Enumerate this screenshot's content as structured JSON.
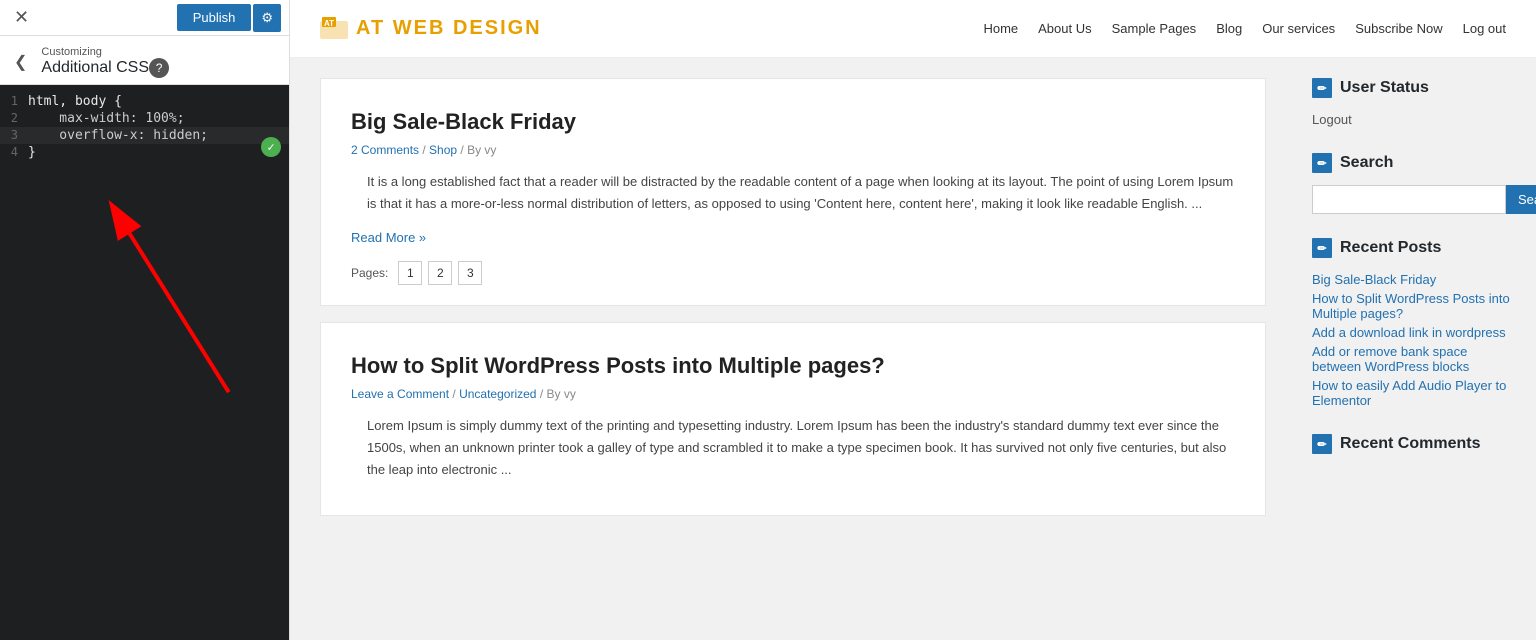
{
  "leftPanel": {
    "publishLabel": "Publish",
    "gearSymbol": "⚙",
    "closeSymbol": "✕",
    "backSymbol": "❮",
    "customizingLabel": "Customizing",
    "sectionTitle": "Additional CSS",
    "helpSymbol": "?",
    "codeLines": [
      {
        "num": "1",
        "text": "html, body {",
        "type": "selector"
      },
      {
        "num": "2",
        "text": "    max-width: 100%;",
        "type": "property"
      },
      {
        "num": "3",
        "text": "    overflow-x: hidden;",
        "type": "property"
      },
      {
        "num": "4",
        "text": "}",
        "type": "brace"
      }
    ]
  },
  "siteHeader": {
    "logoText": "AT WEB DESIGN",
    "nav": [
      {
        "label": "Home",
        "href": "#"
      },
      {
        "label": "About Us",
        "href": "#"
      },
      {
        "label": "Sample Pages",
        "href": "#"
      },
      {
        "label": "Blog",
        "href": "#"
      },
      {
        "label": "Our services",
        "href": "#"
      },
      {
        "label": "Subscribe Now",
        "href": "#"
      },
      {
        "label": "Log out",
        "href": "#"
      }
    ]
  },
  "posts": [
    {
      "title": "Big Sale-Black Friday",
      "meta": "2 Comments / Shop / By vy",
      "excerpt": " It is a long established fact that a reader will be distracted by the readable content of a page when looking at its layout. The point of using Lorem Ipsum is that it has a more-or-less normal distribution of letters, as opposed to using 'Content here, content here', making it look like readable English. ...",
      "readMore": "Read More »",
      "pages": {
        "label": "Pages:",
        "items": [
          "1",
          "2",
          "3"
        ]
      }
    },
    {
      "title": "How to Split WordPress Posts into Multiple pages?",
      "meta": "Leave a Comment / Uncategorized / By vy",
      "excerpt": "Lorem Ipsum is simply dummy text of the printing and typesetting industry. Lorem Ipsum has been the industry's standard dummy text ever since the 1500s, when an unknown printer took a galley of type and scrambled it to make a type specimen book. It has survived not only five centuries, but also the leap into electronic ...",
      "readMore": "",
      "pages": null
    }
  ],
  "sidebar": {
    "userStatus": {
      "title": "User Status",
      "logoutLabel": "Logout"
    },
    "search": {
      "title": "Search",
      "placeholder": "",
      "buttonLabel": "Search"
    },
    "recentPosts": {
      "title": "Recent Posts",
      "items": [
        "Big Sale-Black Friday",
        "How to Split WordPress Posts into Multiple pages?",
        "Add a download link in wordpress",
        "Add or remove bank space between WordPress blocks",
        "How to easily Add Audio Player to Elementor"
      ]
    },
    "recentComments": {
      "title": "Recent Comments"
    }
  }
}
